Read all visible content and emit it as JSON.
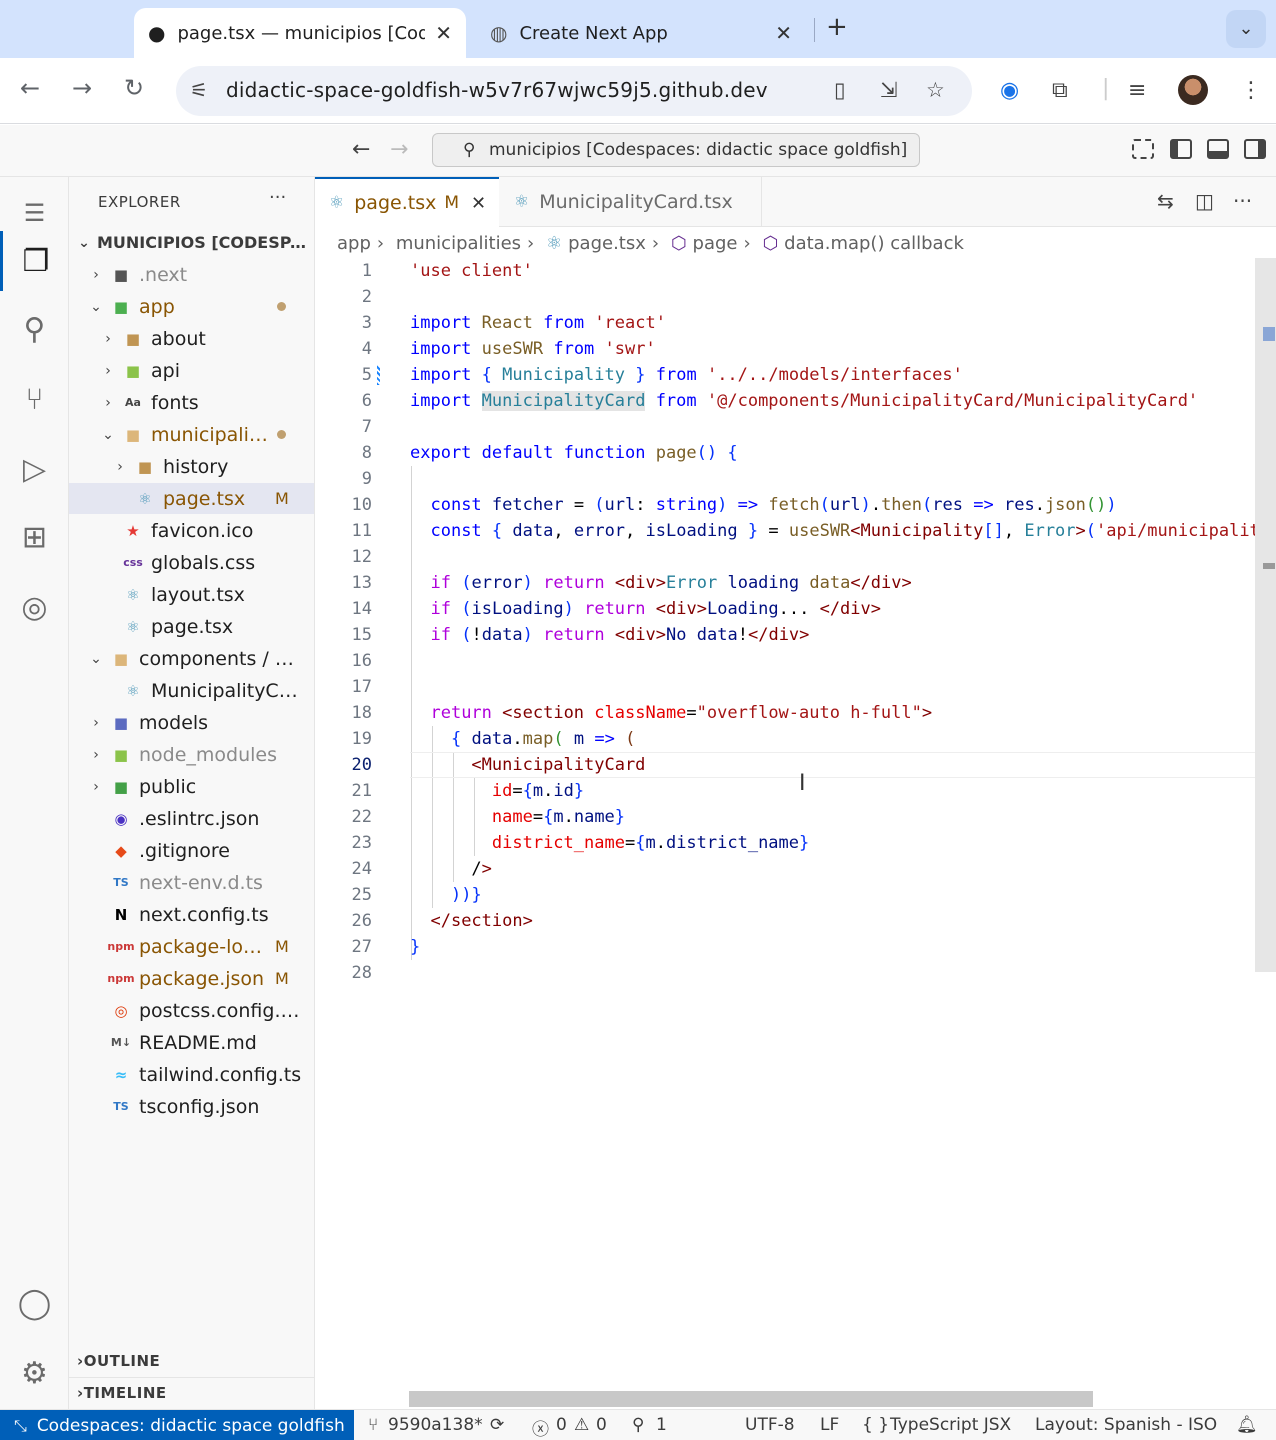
{
  "browser": {
    "tabs": [
      {
        "title": "page.tsx — municipios [Codespaces",
        "icon": "github-icon",
        "active": true
      },
      {
        "title": "Create Next App",
        "icon": "globe-icon",
        "active": false
      }
    ],
    "url": "didactic-space-goldfish-w5v7r67wjwc59j5.github.dev"
  },
  "vscode": {
    "command_center": "municipios [Codespaces: didactic space goldfish]",
    "explorer": {
      "title": "EXPLORER",
      "root": "MUNICIPIOS [CODESPACES: DIDACTIC SPACE GOLDFISH]",
      "items": [
        {
          "label": ".next",
          "indent": 1,
          "chev": "›",
          "icon": "nextjs-folder-icon",
          "dim": true
        },
        {
          "label": "app",
          "indent": 1,
          "chev": "⌄",
          "icon": "app-folder-icon",
          "color": "#895503",
          "dot": true
        },
        {
          "label": "about",
          "indent": 2,
          "chev": "›",
          "icon": "folder-icon"
        },
        {
          "label": "api",
          "indent": 2,
          "chev": "›",
          "icon": "api-folder-icon"
        },
        {
          "label": "fonts",
          "indent": 2,
          "chev": "›",
          "icon": "font-folder-icon"
        },
        {
          "label": "municipalities",
          "indent": 2,
          "chev": "⌄",
          "icon": "folder-open-icon",
          "color": "#895503",
          "dot": true
        },
        {
          "label": "history",
          "indent": 3,
          "chev": "›",
          "icon": "folder-icon"
        },
        {
          "label": "page.tsx",
          "indent": 3,
          "chev": "",
          "icon": "react-icon",
          "color": "#895503",
          "badge": "M",
          "selected": true
        },
        {
          "label": "favicon.ico",
          "indent": 2,
          "chev": "",
          "icon": "favicon-icon"
        },
        {
          "label": "globals.css",
          "indent": 2,
          "chev": "",
          "icon": "css-icon"
        },
        {
          "label": "layout.tsx",
          "indent": 2,
          "chev": "",
          "icon": "react-icon"
        },
        {
          "label": "page.tsx",
          "indent": 2,
          "chev": "",
          "icon": "react-icon"
        },
        {
          "label": "components / MunicipalityCard",
          "indent": 1,
          "chev": "⌄",
          "icon": "folder-open-icon"
        },
        {
          "label": "MunicipalityCard.tsx",
          "indent": 2,
          "chev": "",
          "icon": "react-icon"
        },
        {
          "label": "models",
          "indent": 1,
          "chev": "›",
          "icon": "models-folder-icon"
        },
        {
          "label": "node_modules",
          "indent": 1,
          "chev": "›",
          "icon": "node-folder-icon",
          "dim": true
        },
        {
          "label": "public",
          "indent": 1,
          "chev": "›",
          "icon": "public-folder-icon"
        },
        {
          "label": ".eslintrc.json",
          "indent": 1,
          "chev": "",
          "icon": "eslint-icon"
        },
        {
          "label": ".gitignore",
          "indent": 1,
          "chev": "",
          "icon": "git-icon"
        },
        {
          "label": "next-env.d.ts",
          "indent": 1,
          "chev": "",
          "icon": "ts-icon",
          "dim": true
        },
        {
          "label": "next.config.ts",
          "indent": 1,
          "chev": "",
          "icon": "nextjs-icon"
        },
        {
          "label": "package-lock.json",
          "indent": 1,
          "chev": "",
          "icon": "npm-icon",
          "color": "#895503",
          "badge": "M"
        },
        {
          "label": "package.json",
          "indent": 1,
          "chev": "",
          "icon": "npm-icon",
          "color": "#895503",
          "badge": "M"
        },
        {
          "label": "postcss.config.mjs",
          "indent": 1,
          "chev": "",
          "icon": "postcss-icon"
        },
        {
          "label": "README.md",
          "indent": 1,
          "chev": "",
          "icon": "markdown-icon"
        },
        {
          "label": "tailwind.config.ts",
          "indent": 1,
          "chev": "",
          "icon": "tailwind-icon"
        },
        {
          "label": "tsconfig.json",
          "indent": 1,
          "chev": "",
          "icon": "ts-icon"
        }
      ],
      "outline": "OUTLINE",
      "timeline": "TIMELINE"
    },
    "editor_tabs": [
      {
        "label": "page.tsx",
        "modified": "M",
        "active": true
      },
      {
        "label": "MunicipalityCard.tsx",
        "active": false
      }
    ],
    "breadcrumbs": [
      "app",
      "municipalities",
      "page.tsx",
      "page",
      "data.map() callback"
    ],
    "current_line": 20,
    "code_lines": [
      "'use client'",
      "",
      "import React from 'react'",
      "import useSWR from 'swr'",
      "import { Municipality } from '../../models/interfaces'",
      "import MunicipalityCard from '@/components/MunicipalityCard/MunicipalityCard'",
      "",
      "export default function page() {",
      "",
      "  const fetcher = (url: string) => fetch(url).then(res => res.json())",
      "  const { data, error, isLoading } = useSWR<Municipality[], Error>('api/municipalities', fetcher)",
      "",
      "  if (error) return <div>Error loading data</div>",
      "  if (isLoading) return <div>Loading... </div>",
      "  if (!data) return <div>No data!</div>",
      "",
      "",
      "  return <section className=\"overflow-auto h-full\">",
      "    { data.map( m => (",
      "      <MunicipalityCard",
      "        id={m.id}",
      "        name={m.name}",
      "        district_name={m.district_name}",
      "      />",
      "    ))}",
      "  </section>",
      "}",
      ""
    ],
    "statusbar": {
      "remote": "Codespaces: didactic space goldfish",
      "branch": "9590a138*",
      "errors": "0",
      "warnings": "0",
      "ports": "1",
      "encoding": "UTF-8",
      "eol": "LF",
      "language": "TypeScript JSX",
      "layout": "Layout: Spanish - ISO"
    }
  }
}
